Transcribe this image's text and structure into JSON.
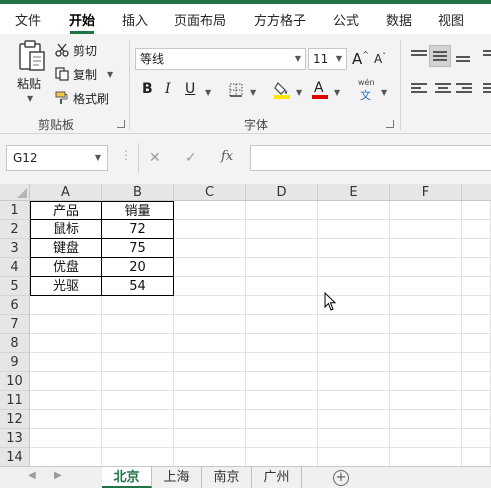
{
  "menu": {
    "tabs": [
      {
        "label": "文件"
      },
      {
        "label": "开始"
      },
      {
        "label": "插入"
      },
      {
        "label": "页面布局"
      },
      {
        "label": "方方格子"
      },
      {
        "label": "公式"
      },
      {
        "label": "数据"
      },
      {
        "label": "视图"
      }
    ],
    "active_tab": "开始"
  },
  "ribbon": {
    "clipboard": {
      "paste_label": "粘贴",
      "cut_label": "剪切",
      "copy_label": "复制",
      "format_painter_label": "格式刷",
      "group_label": "剪贴板"
    },
    "font": {
      "font_name": "等线",
      "font_size": "11",
      "grow_label": "A",
      "shrink_label": "A",
      "bold_label": "B",
      "italic_label": "I",
      "underline_label": "U",
      "font_color_label": "A",
      "phonetic_top": "wén",
      "phonetic_bottom": "文",
      "group_label": "字体"
    }
  },
  "formula_bar": {
    "name_box": "G12",
    "cancel_glyph": "✕",
    "enter_glyph": "✓",
    "fx_label": "fx",
    "formula_value": ""
  },
  "grid": {
    "columns": [
      "A",
      "B",
      "C",
      "D",
      "E",
      "F"
    ],
    "rows": [
      "1",
      "2",
      "3",
      "4",
      "5",
      "6",
      "7",
      "8",
      "9",
      "10",
      "11",
      "12",
      "13",
      "14"
    ],
    "cells": [
      [
        "产品",
        "销量"
      ],
      [
        "鼠标",
        "72"
      ],
      [
        "键盘",
        "75"
      ],
      [
        "优盘",
        "20"
      ],
      [
        "光驱",
        "54"
      ]
    ]
  },
  "sheets": {
    "tabs": [
      {
        "label": "北京"
      },
      {
        "label": "上海"
      },
      {
        "label": "南京"
      },
      {
        "label": "广州"
      }
    ],
    "active": "北京",
    "add_label": "+"
  },
  "colors": {
    "accent": "#217346",
    "font_color_bar": "#e00000",
    "highlight_bar": "#ffe600"
  }
}
